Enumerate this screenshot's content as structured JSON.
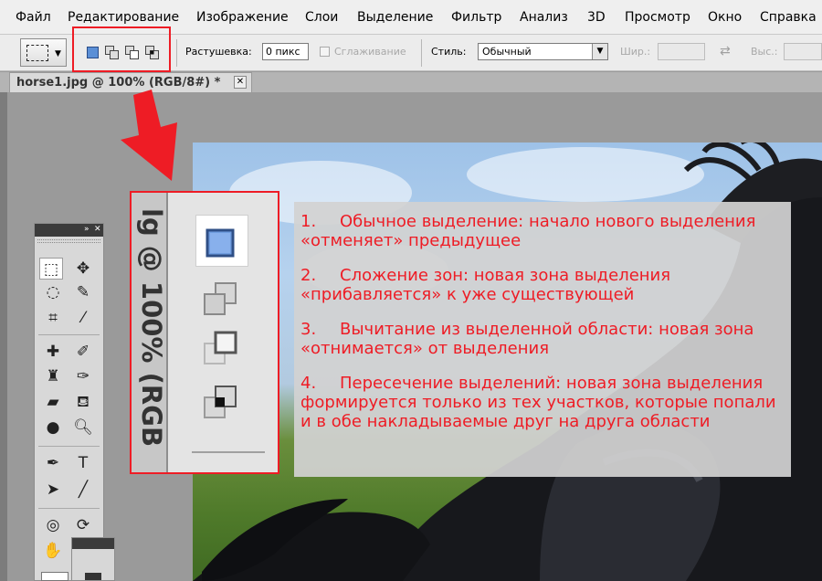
{
  "menu": {
    "items": [
      "Файл",
      "Редактирование",
      "Изображение",
      "Слои",
      "Выделение",
      "Фильтр",
      "Анализ",
      "3D",
      "Просмотр",
      "Окно",
      "Справка"
    ]
  },
  "options_bar": {
    "feather_label": "Растушевка:",
    "feather_value": "0 пикс",
    "antialias_label": "Сглаживание",
    "style_label": "Стиль:",
    "style_value": "Обычный",
    "width_label": "Шир.:",
    "height_label": "Выс.:"
  },
  "document": {
    "tab_title": "horse1.jpg @ 100% (RGB/8#) *",
    "close_glyph": "✕"
  },
  "inset": {
    "tab_text": "lg @ 100% (RGB"
  },
  "annotation": {
    "items": [
      {
        "num": "1.",
        "text": "Обычное выделение: начало нового выделения «отменяет» предыдущее"
      },
      {
        "num": "2.",
        "text": "Сложение зон: новая зона выделения «прибавляется» к уже существующей"
      },
      {
        "num": "3.",
        "text": "Вычитание из выделенной области: новая зона «отнимается» от выделения"
      },
      {
        "num": "4.",
        "text": "Пересечение выделений: новая зона выделения формируется только из тех участков, которые попали и в обе накладываемые друг на друга области"
      }
    ]
  },
  "colors": {
    "highlight": "#ee1c25",
    "annotation_text": "#ee1c25",
    "active_mode_fill": "#5b8fd6"
  },
  "icons": {
    "tools": [
      "rect-marquee-icon",
      "move-icon",
      "lasso-icon",
      "quick-select-icon",
      "crop-icon",
      "eyedropper-icon",
      "spot-heal-icon",
      "brush-icon",
      "clone-stamp-icon",
      "history-brush-icon",
      "eraser-icon",
      "paint-bucket-icon",
      "blur-icon",
      "dodge-icon",
      "pen-icon",
      "type-icon",
      "path-select-icon",
      "line-icon",
      "3d-rotate-icon",
      "3d-orbit-icon",
      "hand-icon"
    ]
  }
}
